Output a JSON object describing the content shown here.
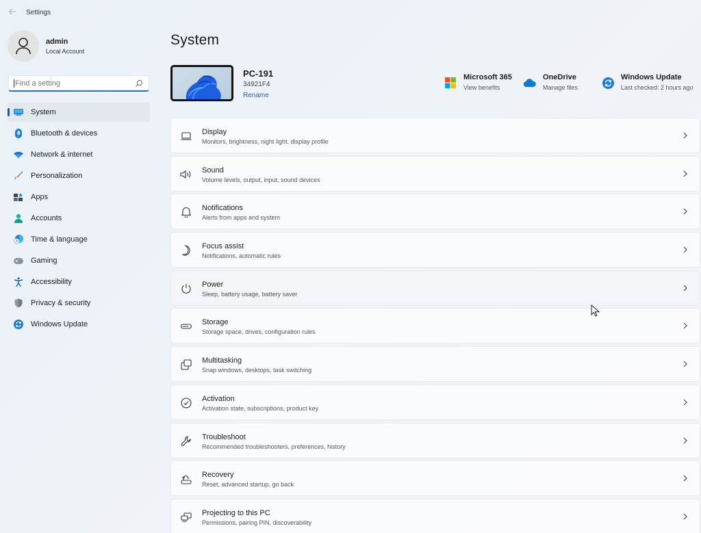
{
  "titlebar": {
    "back_icon": "arrow-left-icon",
    "title": "Settings"
  },
  "profile": {
    "avatar_icon": "person-icon",
    "name": "admin",
    "account_type": "Local Account"
  },
  "search": {
    "placeholder": "Find a setting",
    "value": "",
    "icon": "search-icon"
  },
  "sidebar": {
    "items": [
      {
        "label": "System",
        "icon": "monitor-icon",
        "active": true
      },
      {
        "label": "Bluetooth & devices",
        "icon": "bluetooth-icon",
        "active": false
      },
      {
        "label": "Network & internet",
        "icon": "wifi-icon",
        "active": false
      },
      {
        "label": "Personalization",
        "icon": "brush-icon",
        "active": false
      },
      {
        "label": "Apps",
        "icon": "apps-icon",
        "active": false
      },
      {
        "label": "Accounts",
        "icon": "account-icon",
        "active": false
      },
      {
        "label": "Time & language",
        "icon": "globe-clock-icon",
        "active": false
      },
      {
        "label": "Gaming",
        "icon": "gamepad-icon",
        "active": false
      },
      {
        "label": "Accessibility",
        "icon": "accessibility-icon",
        "active": false
      },
      {
        "label": "Privacy & security",
        "icon": "shield-icon",
        "active": false
      },
      {
        "label": "Windows Update",
        "icon": "update-icon",
        "active": false
      }
    ]
  },
  "main": {
    "title": "System",
    "device": {
      "name": "PC-191",
      "id": "34921F4",
      "rename_label": "Rename"
    },
    "quick_links": [
      {
        "title": "Microsoft 365",
        "subtitle": "View benefits",
        "icon": "microsoft-logo-icon"
      },
      {
        "title": "OneDrive",
        "subtitle": "Manage files",
        "icon": "cloud-icon"
      },
      {
        "title": "Windows Update",
        "subtitle": "Last checked: 2 hours ago",
        "icon": "update-icon"
      }
    ],
    "cards": [
      {
        "title": "Display",
        "subtitle": "Monitors, brightness, night light, display profile",
        "icon": "laptop-icon"
      },
      {
        "title": "Sound",
        "subtitle": "Volume levels, output, input, sound devices",
        "icon": "speaker-icon"
      },
      {
        "title": "Notifications",
        "subtitle": "Alerts from apps and system",
        "icon": "bell-icon"
      },
      {
        "title": "Focus assist",
        "subtitle": "Notifications, automatic rules",
        "icon": "moon-icon"
      },
      {
        "title": "Power",
        "subtitle": "Sleep, battery usage, battery saver",
        "icon": "power-icon",
        "hovered": true
      },
      {
        "title": "Storage",
        "subtitle": "Storage space, drives, configuration rules",
        "icon": "storage-drive-icon"
      },
      {
        "title": "Multitasking",
        "subtitle": "Snap windows, desktops, task switching",
        "icon": "multitasking-icon"
      },
      {
        "title": "Activation",
        "subtitle": "Activation state, subscriptions, product key",
        "icon": "check-circle-icon"
      },
      {
        "title": "Troubleshoot",
        "subtitle": "Recommended troubleshooters, preferences, history",
        "icon": "wrench-icon"
      },
      {
        "title": "Recovery",
        "subtitle": "Reset, advanced startup, go back",
        "icon": "recovery-icon"
      },
      {
        "title": "Projecting to this PC",
        "subtitle": "Permissions, pairing PIN, discoverability",
        "icon": "projecting-icon"
      }
    ]
  },
  "colors": {
    "accent": "#0067c0",
    "link": "#2a5fa8",
    "background": "#eef3f8"
  }
}
